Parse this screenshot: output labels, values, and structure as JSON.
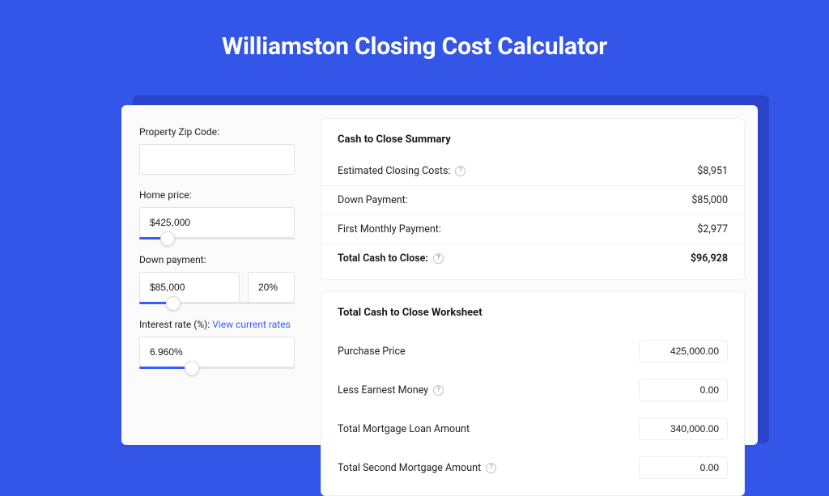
{
  "title": "Williamston Closing Cost Calculator",
  "form": {
    "zip": {
      "label": "Property Zip Code:",
      "value": ""
    },
    "home_price": {
      "label": "Home price:",
      "value": "$425,000",
      "slider_pct": 18
    },
    "down_payment": {
      "label": "Down payment:",
      "value": "$85,000",
      "pct": "20%",
      "slider_pct": 22
    },
    "interest": {
      "label": "Interest rate (%): ",
      "link": "View current rates",
      "value": "6.960%",
      "slider_pct": 34
    }
  },
  "summary": {
    "title": "Cash to Close Summary",
    "rows": [
      {
        "label": "Estimated Closing Costs:",
        "help": true,
        "value": "$8,951",
        "bold": false
      },
      {
        "label": "Down Payment:",
        "help": false,
        "value": "$85,000",
        "bold": false
      },
      {
        "label": "First Monthly Payment:",
        "help": false,
        "value": "$2,977",
        "bold": false
      },
      {
        "label": "Total Cash to Close:",
        "help": true,
        "value": "$96,928",
        "bold": true
      }
    ]
  },
  "worksheet": {
    "title": "Total Cash to Close Worksheet",
    "rows": [
      {
        "label": "Purchase Price",
        "help": false,
        "value": "425,000.00"
      },
      {
        "label": "Less Earnest Money",
        "help": true,
        "value": "0.00"
      },
      {
        "label": "Total Mortgage Loan Amount",
        "help": false,
        "value": "340,000.00"
      },
      {
        "label": "Total Second Mortgage Amount",
        "help": true,
        "value": "0.00"
      }
    ]
  }
}
